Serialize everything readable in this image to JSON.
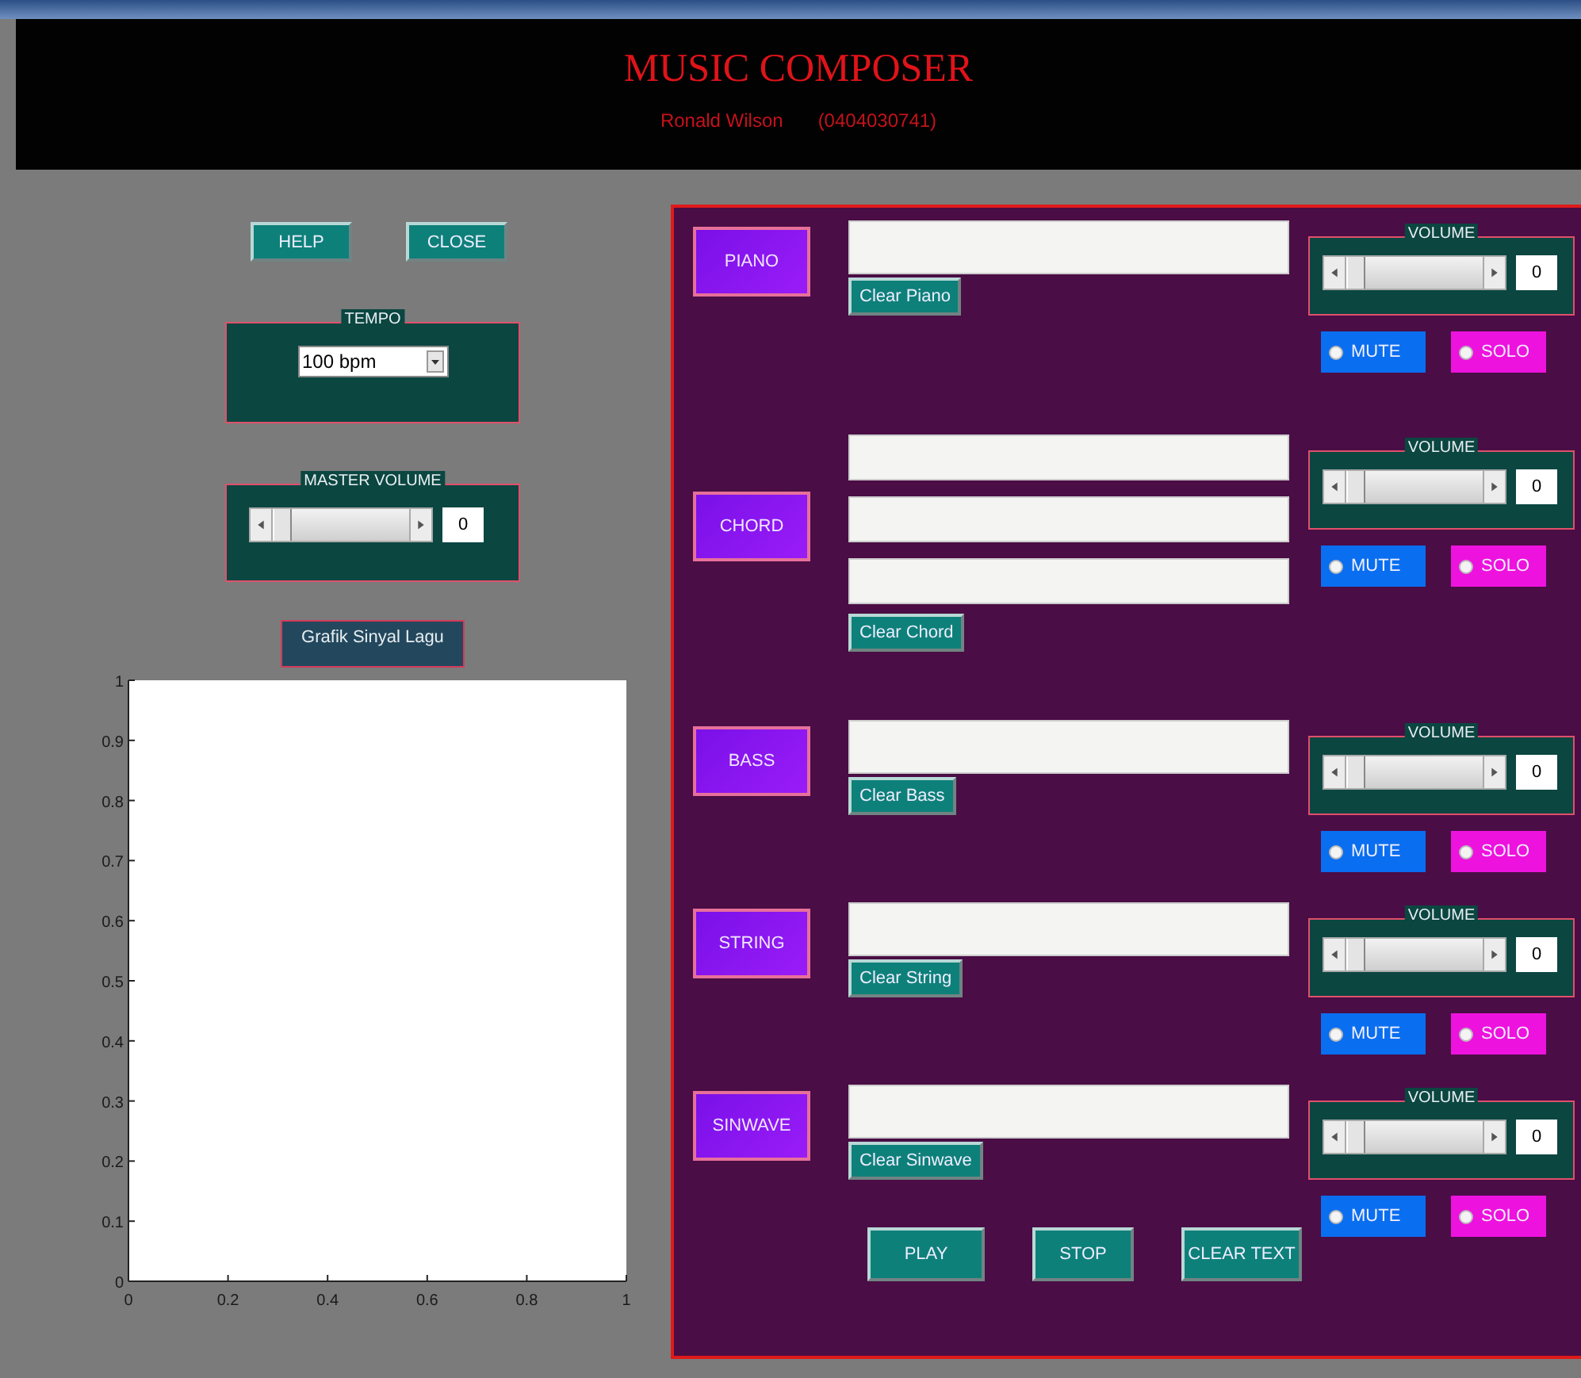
{
  "header": {
    "title": "MUSIC COMPOSER",
    "author": "Ronald Wilson",
    "student_id": "(0404030741)"
  },
  "top_buttons": [
    "HELP",
    "CLOSE"
  ],
  "tempo": {
    "label": "TEMPO",
    "value": "100 bpm"
  },
  "master_volume": {
    "label": "MASTER VOLUME",
    "level": 0,
    "reading": "0"
  },
  "graph": {
    "title": "Grafik Sinyal Lagu",
    "chart_data": {
      "type": "line",
      "xlim": [
        0,
        1
      ],
      "ylim": [
        0,
        1
      ],
      "xticks": [
        0,
        0.2,
        0.4,
        0.6,
        0.8,
        1
      ],
      "yticks": [
        0,
        0.1,
        0.2,
        0.3,
        0.4,
        0.5,
        0.6,
        0.7,
        0.8,
        0.9,
        1
      ]
    }
  },
  "tracks": [
    {
      "name": "PIANO",
      "fields": [
        {
          "kind": "text"
        }
      ],
      "clear_button": "Clear Piano",
      "volume": {
        "label": "VOLUME",
        "level": 0,
        "reading": "0"
      },
      "mute": {
        "label": "MUTE",
        "checked": false
      },
      "solo": {
        "label": "SOLO",
        "checked": false
      }
    },
    {
      "name": "CHORD",
      "fields": [
        {
          "kind": "text"
        },
        {
          "kind": "text"
        },
        {
          "kind": "text"
        }
      ],
      "clear_button": "Clear Chord",
      "volume": {
        "label": "VOLUME",
        "level": 0,
        "reading": "0"
      },
      "mute": {
        "label": "MUTE",
        "checked": false
      },
      "solo": {
        "label": "SOLO",
        "checked": false
      }
    },
    {
      "name": "BASS",
      "fields": [
        {
          "kind": "text"
        }
      ],
      "clear_button": "Clear Bass",
      "volume": {
        "label": "VOLUME",
        "level": 0,
        "reading": "0"
      },
      "mute": {
        "label": "MUTE",
        "checked": false
      },
      "solo": {
        "label": "SOLO",
        "checked": false
      }
    },
    {
      "name": "STRING",
      "fields": [
        {
          "kind": "text"
        }
      ],
      "clear_button": "Clear String",
      "volume": {
        "label": "VOLUME",
        "level": 0,
        "reading": "0"
      },
      "mute": {
        "label": "MUTE",
        "checked": false
      },
      "solo": {
        "label": "SOLO",
        "checked": false
      }
    },
    {
      "name": "SINWAVE",
      "fields": [
        {
          "kind": "text"
        }
      ],
      "clear_button": "Clear Sinwave",
      "volume": {
        "label": "VOLUME",
        "level": 0,
        "reading": "0"
      },
      "mute": {
        "label": "MUTE",
        "checked": false
      },
      "solo": {
        "label": "SOLO",
        "checked": false
      }
    }
  ],
  "actions": [
    "PLAY",
    "STOP",
    "CLEAR TEXT"
  ]
}
